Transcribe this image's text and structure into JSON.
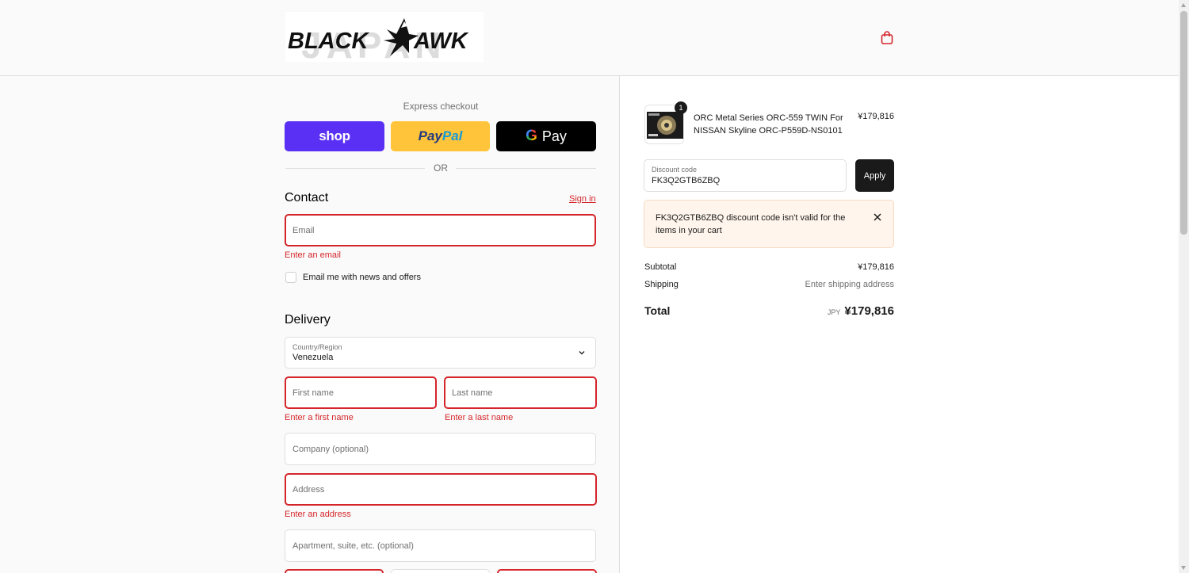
{
  "header": {
    "logo_text": "BLACK HAWK",
    "logo_watermark": "JAPAN",
    "cart_icon": "shopping-bag-icon",
    "accent_color": "#d4252a"
  },
  "express": {
    "title": "Express checkout",
    "shop_label": "shop",
    "paypal_label_1": "Pay",
    "paypal_label_2": "Pal",
    "gpay_g": "G",
    "gpay_label": "Pay",
    "or_label": "OR"
  },
  "contact": {
    "title": "Contact",
    "sign_in": "Sign in",
    "email_placeholder": "Email",
    "email_error": "Enter an email",
    "newsletter_label": "Email me with news and offers"
  },
  "delivery": {
    "title": "Delivery",
    "country_label": "Country/Region",
    "country_value": "Venezuela",
    "first_name_placeholder": "First name",
    "first_name_error": "Enter a first name",
    "last_name_placeholder": "Last name",
    "last_name_error": "Enter a last name",
    "company_placeholder": "Company (optional)",
    "address_placeholder": "Address",
    "address_error": "Enter an address",
    "apartment_placeholder": "Apartment, suite, etc. (optional)"
  },
  "order": {
    "product_name": "ORC Metal Series ORC-559 TWIN For NISSAN Skyline ORC-P559D-NS0101",
    "product_price": "¥179,816",
    "quantity": "1",
    "discount_label": "Discount code",
    "discount_value": "FK3Q2GTB6ZBQ",
    "apply_label": "Apply",
    "alert_message": "FK3Q2GTB6ZBQ discount code isn't valid for the items in your cart",
    "subtotal_label": "Subtotal",
    "subtotal_value": "¥179,816",
    "shipping_label": "Shipping",
    "shipping_value": "Enter shipping address",
    "total_label": "Total",
    "total_currency": "JPY",
    "total_value": "¥179,816"
  }
}
